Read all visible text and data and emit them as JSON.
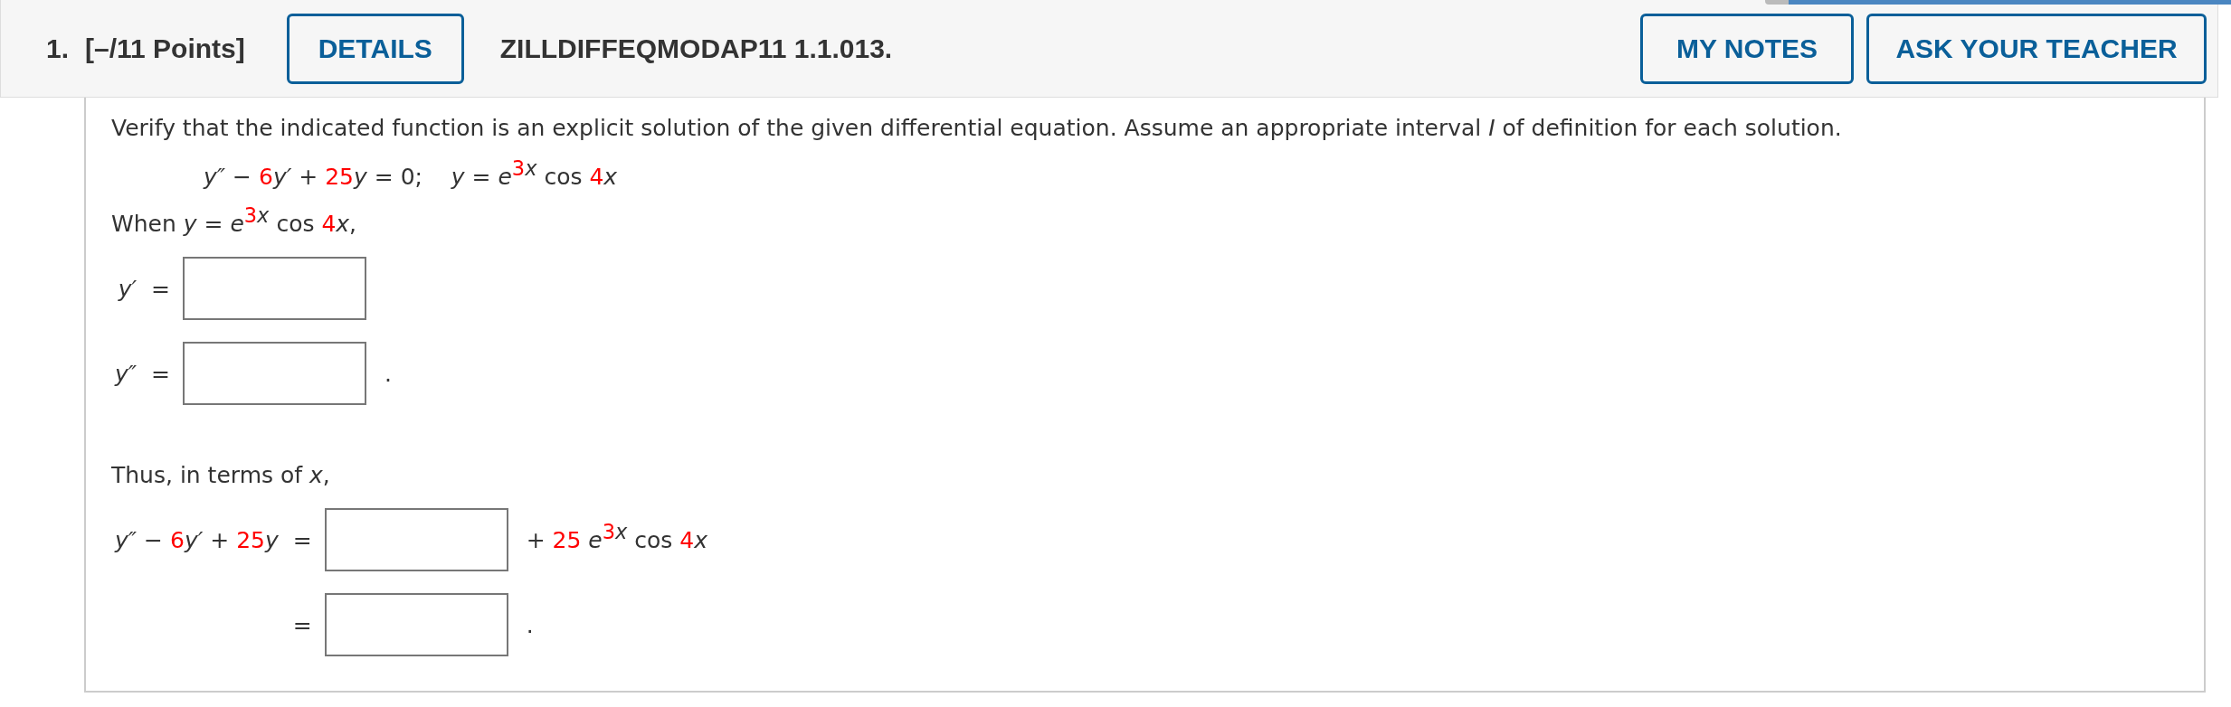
{
  "header": {
    "number": "1.",
    "points": "[–/11 Points]",
    "details_button": "DETAILS",
    "problem_id": "ZILLDIFFEQMODAP11 1.1.013.",
    "buttons": [
      "MY NOTES",
      "ASK YOUR TEACHER"
    ]
  },
  "blocks": [
    {
      "kind": "paragraph",
      "parts": [
        {
          "text": "Verify that the indicated function is an explicit solution of the given differential equation. Assume an appropriate interval ",
          "kind": "text"
        },
        {
          "text": "I",
          "kind": "var"
        },
        {
          "text": " of definition for each solution.",
          "kind": "text"
        }
      ]
    },
    {
      "kind": "display",
      "parts": [
        {
          "text": "y″",
          "kind": "var"
        },
        {
          "text": " − ",
          "kind": "text"
        },
        {
          "text": "6",
          "kind": "coef"
        },
        {
          "text": "y′",
          "kind": "var"
        },
        {
          "text": " + ",
          "kind": "text"
        },
        {
          "text": "25",
          "kind": "coef"
        },
        {
          "text": "y",
          "kind": "var"
        },
        {
          "text": " = 0;    ",
          "kind": "text"
        },
        {
          "text": "y",
          "kind": "var"
        },
        {
          "text": " = ",
          "kind": "text"
        },
        {
          "text": "e",
          "kind": "var"
        },
        {
          "kind": "exp",
          "parts": [
            {
              "text": "3",
              "kind": "coef"
            },
            {
              "text": "x",
              "kind": "var"
            }
          ]
        },
        {
          "text": " cos ",
          "kind": "text"
        },
        {
          "text": "4",
          "kind": "coef"
        },
        {
          "text": "x",
          "kind": "var"
        }
      ]
    },
    {
      "kind": "paragraph",
      "parts": [
        {
          "text": "When ",
          "kind": "text"
        },
        {
          "text": "y",
          "kind": "var"
        },
        {
          "text": " = ",
          "kind": "text"
        },
        {
          "text": "e",
          "kind": "var"
        },
        {
          "kind": "exp",
          "parts": [
            {
              "text": "3",
              "kind": "coef"
            },
            {
              "text": "x",
              "kind": "var"
            }
          ]
        },
        {
          "text": " cos ",
          "kind": "text"
        },
        {
          "text": "4",
          "kind": "coef"
        },
        {
          "text": "x",
          "kind": "var"
        },
        {
          "text": ",",
          "kind": "text"
        }
      ]
    },
    {
      "kind": "answers",
      "rows": [
        {
          "lhs": [
            {
              "text": "y′",
              "kind": "var"
            },
            {
              "text": "  =",
              "kind": "text"
            }
          ]
        },
        {
          "lhs": [
            {
              "text": "y″",
              "kind": "var"
            },
            {
              "text": "  =",
              "kind": "text"
            }
          ],
          "suffix": [
            {
              "text": ".",
              "kind": "text"
            }
          ]
        }
      ]
    },
    {
      "kind": "paragraph",
      "parts": [
        {
          "text": "Thus, in terms of ",
          "kind": "text"
        },
        {
          "text": "x",
          "kind": "var"
        },
        {
          "text": ",",
          "kind": "text"
        }
      ]
    },
    {
      "kind": "answers",
      "rows": [
        {
          "lhs": [
            {
              "text": "y″",
              "kind": "var"
            },
            {
              "text": " − ",
              "kind": "text"
            },
            {
              "text": "6",
              "kind": "coef"
            },
            {
              "text": "y′",
              "kind": "var"
            },
            {
              "text": " + ",
              "kind": "text"
            },
            {
              "text": "25",
              "kind": "coef"
            },
            {
              "text": "y",
              "kind": "var"
            },
            {
              "text": "  =",
              "kind": "text"
            }
          ],
          "suffix": [
            {
              "text": "+ ",
              "kind": "text"
            },
            {
              "text": "25",
              "kind": "coef"
            },
            {
              "text": " e",
              "kind": "var"
            },
            {
              "kind": "exp",
              "parts": [
                {
                  "text": "3",
                  "kind": "coef"
                },
                {
                  "text": "x",
                  "kind": "var"
                }
              ]
            },
            {
              "text": " cos ",
              "kind": "text"
            },
            {
              "text": "4",
              "kind": "coef"
            },
            {
              "text": "x",
              "kind": "var"
            }
          ]
        },
        {
          "lhs": [
            {
              "text": "=",
              "kind": "text"
            }
          ],
          "suffix": [
            {
              "text": ".",
              "kind": "text"
            }
          ]
        }
      ]
    }
  ]
}
